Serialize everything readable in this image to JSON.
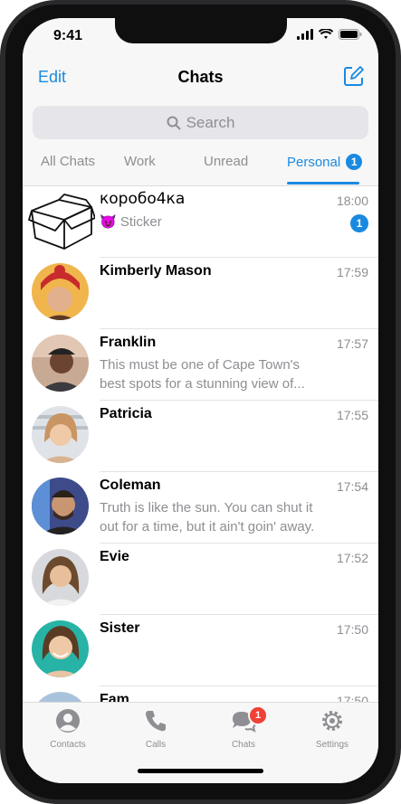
{
  "status_bar": {
    "time": "9:41"
  },
  "header": {
    "edit_label": "Edit",
    "title": "Chats"
  },
  "search": {
    "placeholder": "Search"
  },
  "tabs": [
    {
      "label": "All Chats"
    },
    {
      "label": "Work"
    },
    {
      "label": "Unread"
    },
    {
      "label": "Personal",
      "badge": "1",
      "active": true
    }
  ],
  "chats": [
    {
      "name": "коробо4ка",
      "message": "😈 Sticker",
      "time": "18:00",
      "unread": "1",
      "avatar": "box-drawing"
    },
    {
      "name": "Kimberly Mason",
      "message": "",
      "time": "17:59"
    },
    {
      "name": "Franklin",
      "message": "This must be one of Cape Town's best spots for a stunning view of...",
      "time": "17:57"
    },
    {
      "name": "Patricia",
      "message": "",
      "time": "17:55"
    },
    {
      "name": "Coleman",
      "message": "Truth is like the sun. You can shut it out for a time, but it ain't goin' away.",
      "time": "17:54"
    },
    {
      "name": "Evie",
      "message": "",
      "time": "17:52"
    },
    {
      "name": "Sister",
      "message": "",
      "time": "17:50"
    },
    {
      "name": "Fam",
      "message": "",
      "time": "17:50"
    }
  ],
  "tabbar": [
    {
      "label": "Contacts",
      "icon": "person-icon"
    },
    {
      "label": "Calls",
      "icon": "phone-icon"
    },
    {
      "label": "Chats",
      "icon": "chat-bubbles-icon",
      "badge": "1"
    },
    {
      "label": "Settings",
      "icon": "gear-icon"
    }
  ],
  "colors": {
    "accent": "#1a8ae0",
    "badge_red": "#ef4136"
  }
}
